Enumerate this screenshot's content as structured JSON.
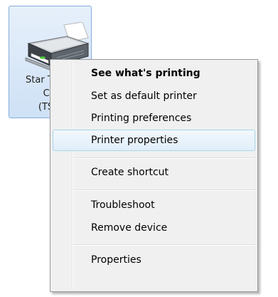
{
  "device": {
    "label_lines": [
      "Star TS",
      "Cut",
      "(TSP"
    ],
    "icon": "printer-icon"
  },
  "context_menu": {
    "items": [
      {
        "label": "See what's printing",
        "bold": true
      },
      {
        "label": "Set as default printer"
      },
      {
        "label": "Printing preferences"
      },
      {
        "label": "Printer properties",
        "highlighted": true
      },
      {
        "label": "Create shortcut"
      },
      {
        "label": "Troubleshoot"
      },
      {
        "label": "Remove device"
      },
      {
        "label": "Properties"
      }
    ]
  },
  "colors": {
    "selection_border": "#84acdd",
    "selection_fill": "#cfe1f6",
    "menu_background": "#f0f0f0",
    "hover_border": "#a8d8eb"
  }
}
